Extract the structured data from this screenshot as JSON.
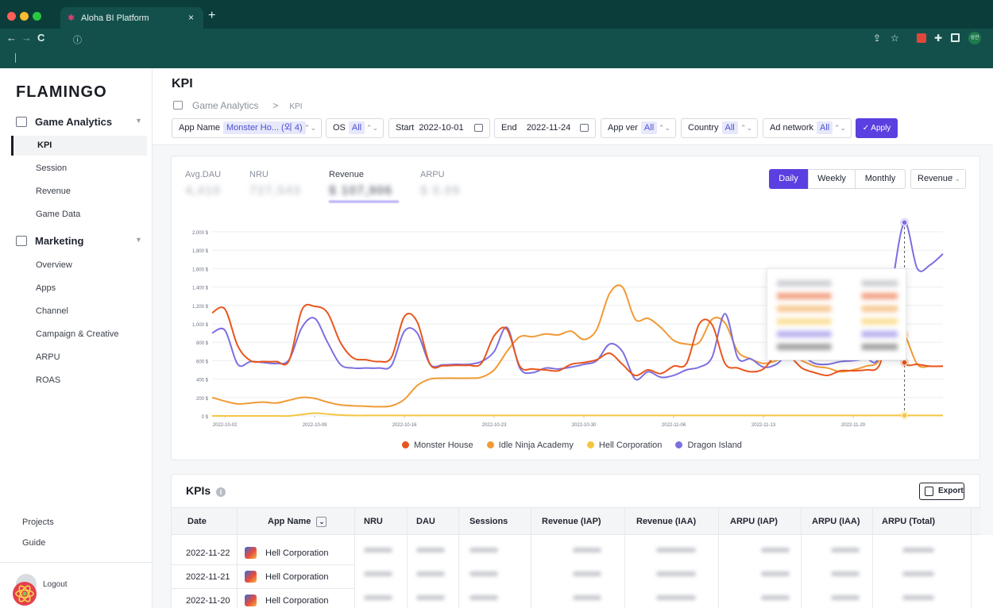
{
  "browser": {
    "tab_title": "Aloha BI Platform",
    "tab_close": "×",
    "new_tab": "+",
    "favicon": "✱",
    "nav_back": "←",
    "nav_forward": "→",
    "nav_reload": "C",
    "site_info": "ⓘ",
    "profile_badge": "성관"
  },
  "sidebar": {
    "logo": "FLAMINGO",
    "sections": [
      {
        "label": "Game Analytics",
        "items": [
          "KPI",
          "Session",
          "Revenue",
          "Game Data"
        ]
      },
      {
        "label": "Marketing",
        "items": [
          "Overview",
          "Apps",
          "Channel",
          "Campaign & Creative",
          "ARPU",
          "ROAS"
        ]
      }
    ],
    "active_item": "KPI",
    "footer": [
      "Projects",
      "Guide"
    ],
    "logout": "Logout"
  },
  "header": {
    "title": "KPI",
    "breadcrumb": [
      "Game Analytics",
      "KPI"
    ],
    "breadcrumb_sep": ">"
  },
  "filters": {
    "app_name_label": "App Name",
    "app_name_value": "Monster Ho... (외 4)",
    "os_label": "OS",
    "os_value": "All",
    "start_label": "Start",
    "start_value": "2022-10-01",
    "end_label": "End",
    "end_value": "2022-11-24",
    "app_ver_label": "App ver",
    "app_ver_value": "All",
    "country_label": "Country",
    "country_value": "All",
    "ad_network_label": "Ad network",
    "ad_network_value": "All",
    "apply_label": "✓ Apply",
    "updown_glyph": "⌃⌄"
  },
  "metrics": {
    "labels": [
      "Avg.DAU",
      "NRU",
      "Revenue",
      "ARPU"
    ],
    "values": [
      "4,410",
      "727,543",
      "$ 107,906",
      "$ 0.09"
    ],
    "selected": "Revenue"
  },
  "period": {
    "options": [
      "Daily",
      "Weekly",
      "Monthly"
    ],
    "selected": "Daily"
  },
  "measure_select": "Revenue",
  "chart_data": {
    "type": "line",
    "y_ticks": [
      "2,000 $",
      "1,800 $",
      "1,600 $",
      "1,400 $",
      "1,200 $",
      "1,000 $",
      "800 $",
      "600 $",
      "400 $",
      "200 $",
      "0 $"
    ],
    "ylim": [
      0,
      2000
    ],
    "x_ticks": [
      "2022-10-02",
      "2022-10-09",
      "2022-10-16",
      "2022-10-23",
      "2022-10-30",
      "2022-11-06",
      "2022-11-13",
      "2022-11-20"
    ],
    "grid": true,
    "legend_position": "bottom",
    "series": [
      {
        "name": "Monster House",
        "color": "#e8561e",
        "values": [
          1120,
          1160,
          760,
          600,
          590,
          590,
          600,
          1150,
          1190,
          1120,
          800,
          630,
          610,
          590,
          640,
          1080,
          1020,
          560,
          545,
          550,
          550,
          570,
          870,
          940,
          540,
          510,
          500,
          490,
          560,
          580,
          610,
          680,
          560,
          440,
          500,
          460,
          540,
          570,
          1000,
          990,
          570,
          520,
          480,
          510,
          660,
          650,
          520,
          470,
          440,
          490,
          490,
          500,
          540,
          930,
          580,
          560,
          540,
          540
        ]
      },
      {
        "name": "Idle Ninja Academy",
        "color": "#f19a35",
        "values": [
          200,
          160,
          130,
          140,
          150,
          140,
          170,
          200,
          190,
          150,
          120,
          110,
          105,
          100,
          110,
          180,
          330,
          400,
          410,
          410,
          410,
          420,
          500,
          700,
          860,
          860,
          890,
          880,
          920,
          830,
          940,
          1330,
          1400,
          1050,
          1060,
          960,
          820,
          780,
          800,
          1050,
          1010,
          700,
          620,
          570,
          600,
          660,
          600,
          540,
          520,
          480,
          500,
          540,
          600,
          960,
          880,
          560,
          540,
          540
        ]
      },
      {
        "name": "Hell Corporation",
        "color": "#f5c542",
        "values": [
          0,
          0,
          0,
          0,
          0,
          0,
          0,
          15,
          30,
          20,
          10,
          5,
          5,
          5,
          5,
          5,
          5,
          5,
          5,
          5,
          5,
          5,
          5,
          5,
          5,
          5,
          5,
          5,
          5,
          5,
          5,
          5,
          5,
          5,
          5,
          5,
          5,
          5,
          5,
          5,
          5,
          5,
          5,
          5,
          5,
          5,
          5,
          5,
          5,
          5,
          5,
          5,
          5,
          5,
          5,
          5,
          5,
          5
        ]
      },
      {
        "name": "Dragon Island",
        "color": "#7c6fe0",
        "values": [
          900,
          930,
          560,
          590,
          580,
          570,
          610,
          960,
          1060,
          800,
          560,
          520,
          520,
          520,
          550,
          920,
          900,
          560,
          555,
          560,
          560,
          590,
          700,
          960,
          520,
          470,
          520,
          510,
          530,
          560,
          600,
          780,
          700,
          400,
          480,
          420,
          440,
          500,
          530,
          640,
          1110,
          630,
          620,
          530,
          560,
          680,
          650,
          570,
          560,
          590,
          600,
          620,
          640,
          1400,
          2100,
          1600,
          1640,
          1760
        ]
      }
    ]
  },
  "tooltip": {
    "rows": 5
  },
  "kpis": {
    "title": "KPIs",
    "info_glyph": "i",
    "export_label": "Export",
    "columns": [
      "Date",
      "App Name",
      "NRU",
      "DAU",
      "Sessions",
      "Revenue (IAP)",
      "Revenue (IAA)",
      "ARPU (IAP)",
      "ARPU (IAA)",
      "ARPU (Total)"
    ],
    "rows": [
      {
        "date": "2022-11-22",
        "app": "Hell Corporation"
      },
      {
        "date": "2022-11-21",
        "app": "Hell Corporation"
      },
      {
        "date": "2022-11-20",
        "app": "Hell Corporation"
      }
    ],
    "app_filter_glyph": "⌄"
  }
}
